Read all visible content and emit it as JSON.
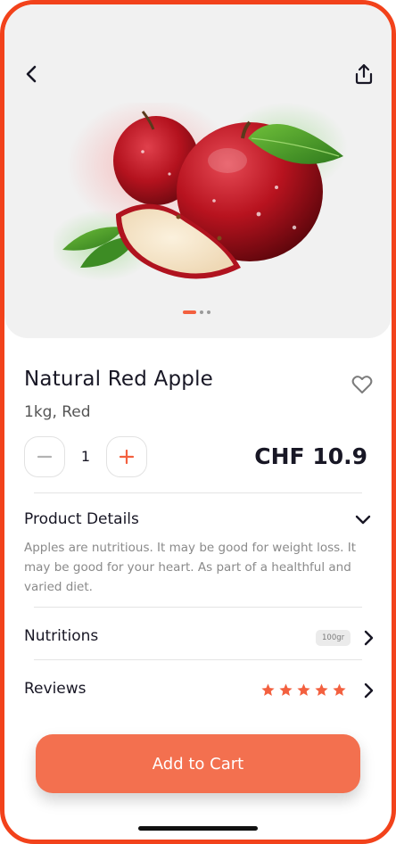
{
  "product": {
    "name": "Natural Red Apple",
    "variant": "1kg, Red",
    "quantity": "1",
    "price": "CHF 10.9"
  },
  "carousel": {
    "pages": 3,
    "active_page": 1
  },
  "sections": {
    "details": {
      "title": "Product Details",
      "description": "Apples are nutritious. It may be good for weight loss. It may be good for your heart. As part of a healthful and varied diet."
    },
    "nutritions": {
      "title": "Nutritions",
      "badge": "100gr"
    },
    "reviews": {
      "title": "Reviews",
      "rating": 5,
      "max_rating": 5
    }
  },
  "actions": {
    "add_to_cart_label": "Add to Cart"
  },
  "icons": {
    "back": "back-arrow-icon",
    "share": "share-icon",
    "favorite": "heart-icon",
    "minus": "minus-icon",
    "plus": "plus-icon",
    "expand": "chevron-down-icon",
    "next": "chevron-right-icon",
    "star": "star-icon"
  },
  "colors": {
    "accent": "#f3704f",
    "frame": "#f2421b",
    "hero_bg": "#f1f1f1",
    "star": "#f3603f"
  }
}
